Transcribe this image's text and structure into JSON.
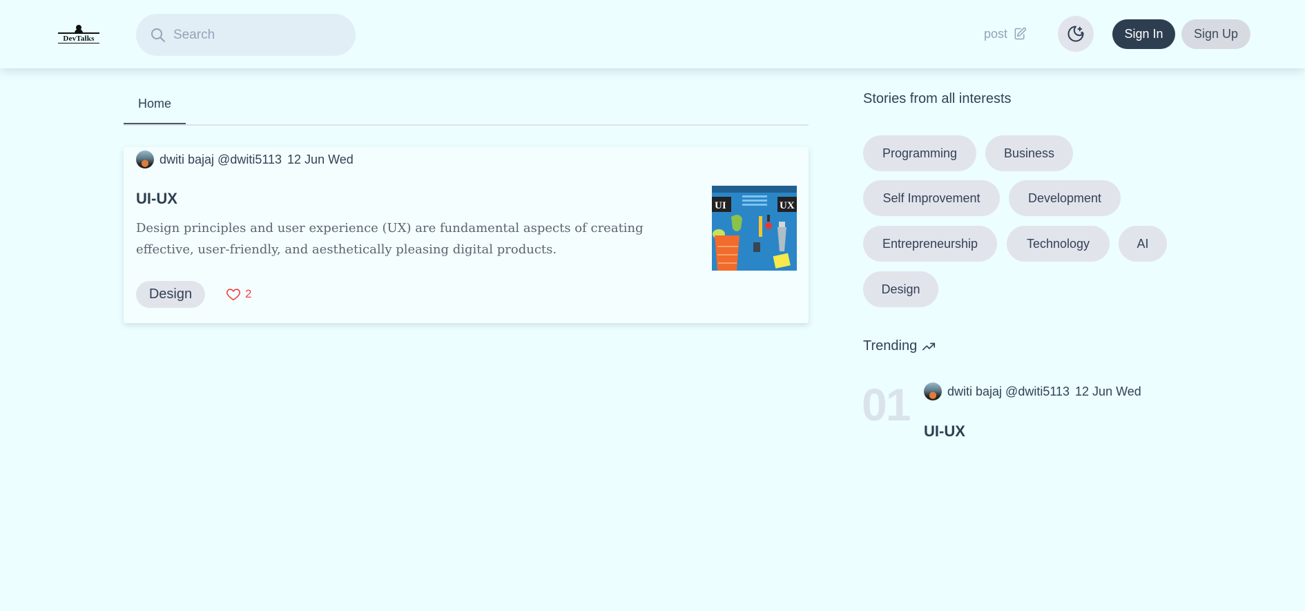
{
  "brand": {
    "logo_text": "DevTalks"
  },
  "search": {
    "placeholder": "Search",
    "icon": "search-icon"
  },
  "header": {
    "post_label": "post",
    "post_icon": "edit-icon",
    "theme_icon": "moon-stars-icon",
    "signin_label": "Sign In",
    "signup_label": "Sign Up"
  },
  "tabs": [
    {
      "label": "Home",
      "active": true
    }
  ],
  "feed": [
    {
      "author": "dwiti bajaj @dwiti5113",
      "date": "12 Jun Wed",
      "title": "UI-UX",
      "description": "Design principles and user experience (UX) are fundamental aspects of creating effective, user-friendly, and aesthetically pleasing digital products.",
      "tag": "Design",
      "likes": "2",
      "thumbnail_labels": [
        "UI",
        "UX"
      ]
    }
  ],
  "sidebar": {
    "interests_title": "Stories from all interests",
    "interests": [
      "Programming",
      "Business",
      "Self Improvement",
      "Development",
      "Entrepreneurship",
      "Technology",
      "AI",
      "Design"
    ],
    "trending_title": "Trending",
    "trending_icon": "trending-up-icon",
    "trending": [
      {
        "rank": "01",
        "author": "dwiti bajaj @dwiti5113",
        "date": "12 Jun Wed",
        "title": "UI-UX"
      }
    ]
  },
  "colors": {
    "background": "#ecfeff",
    "primary_button": "#2d3e50",
    "chip": "#e2e4ec",
    "like": "#ef4444"
  }
}
